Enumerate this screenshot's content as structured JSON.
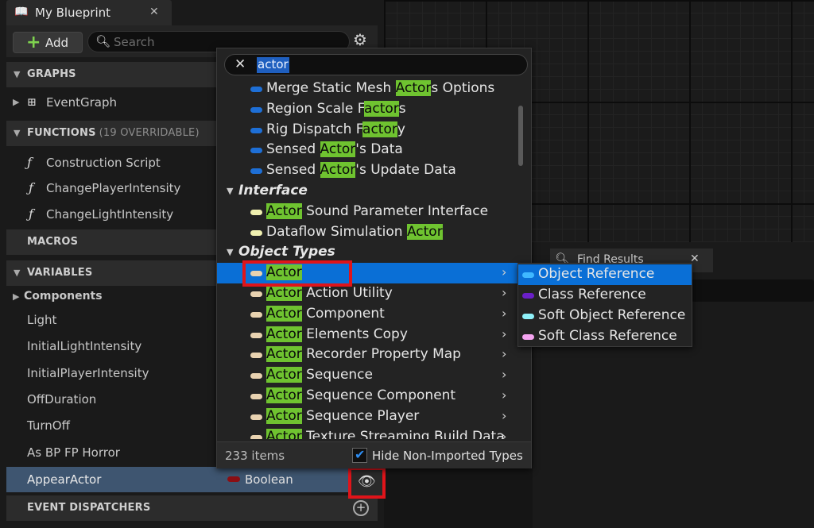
{
  "window": {
    "tab_title": "My Blueprint",
    "tab_icon": "book-icon",
    "close_glyph": "✕"
  },
  "toolbar": {
    "add_label": "Add",
    "search_placeholder": "Search"
  },
  "sections": {
    "graphs": "GRAPHS",
    "functions": "FUNCTIONS",
    "functions_sub": "(19 OVERRIDABLE)",
    "macros": "MACROS",
    "variables": "VARIABLES",
    "event_dispatchers": "EVENT DISPATCHERS"
  },
  "graphs": [
    "EventGraph"
  ],
  "functions": [
    "Construction Script",
    "ChangePlayerIntensity",
    "ChangeLightIntensity"
  ],
  "variables": {
    "components_label": "Components",
    "items": [
      "Light",
      "InitialLightIntensity",
      "InitialPlayerIntensity",
      "OffDuration",
      "TurnOff",
      "As BP FP Horror"
    ],
    "selected": {
      "name": "AppearActor",
      "type": "Boolean",
      "type_color": "#8b0f14"
    }
  },
  "find_results": {
    "label": "Find Results"
  },
  "menu": {
    "search_value": "actor",
    "items_count": "233 items",
    "hide_label": "Hide Non-Imported Types",
    "hide_checked": true,
    "list": [
      {
        "kind": "item",
        "pre": "Merge Static Mesh ",
        "hl": "Actor",
        "post": "s Options",
        "color": "#1e6fd6"
      },
      {
        "kind": "item",
        "pre": "Region Scale F",
        "hl": "actor",
        "post": "s",
        "color": "#1e6fd6"
      },
      {
        "kind": "item",
        "pre": "Rig Dispatch F",
        "hl": "actor",
        "post": "y",
        "color": "#1e6fd6"
      },
      {
        "kind": "item",
        "pre": "Sensed ",
        "hl": "Actor",
        "post": "'s Data",
        "color": "#1e6fd6"
      },
      {
        "kind": "item",
        "pre": "Sensed ",
        "hl": "Actor",
        "post": "'s Update Data",
        "color": "#1e6fd6"
      },
      {
        "kind": "cat",
        "name": "Interface"
      },
      {
        "kind": "item",
        "pre": "",
        "hl": "Actor",
        "post": " Sound Parameter Interface",
        "color": "#f0f0b0"
      },
      {
        "kind": "item",
        "pre": "Dataflow Simulation ",
        "hl": "Actor",
        "post": "",
        "color": "#f0f0b0"
      },
      {
        "kind": "cat",
        "name": "Object Types"
      },
      {
        "kind": "item",
        "pre": "",
        "hl": "Actor",
        "post": "",
        "color": "#e8d2b0",
        "chevron": true,
        "selected": true
      },
      {
        "kind": "item",
        "pre": "",
        "hl": "Actor",
        "post": " Action Utility",
        "color": "#e8d2b0",
        "chevron": true
      },
      {
        "kind": "item",
        "pre": "",
        "hl": "Actor",
        "post": " Component",
        "color": "#e8d2b0",
        "chevron": true
      },
      {
        "kind": "item",
        "pre": "",
        "hl": "Actor",
        "post": " Elements Copy",
        "color": "#e8d2b0",
        "chevron": true
      },
      {
        "kind": "item",
        "pre": "",
        "hl": "Actor",
        "post": " Recorder Property Map",
        "color": "#e8d2b0",
        "chevron": true
      },
      {
        "kind": "item",
        "pre": "",
        "hl": "Actor",
        "post": " Sequence",
        "color": "#e8d2b0",
        "chevron": true
      },
      {
        "kind": "item",
        "pre": "",
        "hl": "Actor",
        "post": " Sequence Component",
        "color": "#e8d2b0",
        "chevron": true
      },
      {
        "kind": "item",
        "pre": "",
        "hl": "Actor",
        "post": " Sequence Player",
        "color": "#e8d2b0",
        "chevron": true
      },
      {
        "kind": "item",
        "pre": "",
        "hl": "Actor",
        "post": " Texture Streaming Build Data",
        "color": "#e8d2b0",
        "chevron": true
      }
    ]
  },
  "submenu": [
    {
      "label": "Object Reference",
      "color": "#3fb8ff",
      "selected": true
    },
    {
      "label": "Class Reference",
      "color": "#6a1fc8"
    },
    {
      "label": "Soft Object Reference",
      "color": "#8ef0f8"
    },
    {
      "label": "Soft Class Reference",
      "color": "#f4a4f0"
    }
  ]
}
